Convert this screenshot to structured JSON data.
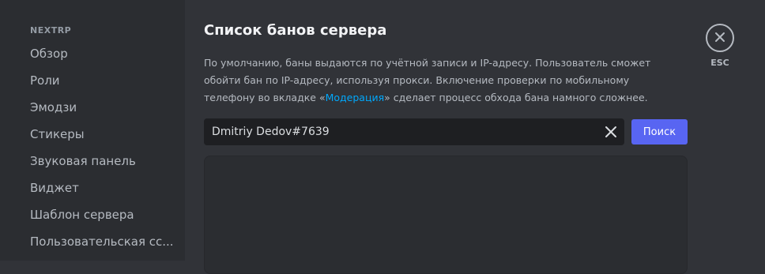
{
  "sidebar": {
    "header": "NEXTRP",
    "items": [
      {
        "label": "Обзор"
      },
      {
        "label": "Роли"
      },
      {
        "label": "Эмодзи"
      },
      {
        "label": "Стикеры"
      },
      {
        "label": "Звуковая панель"
      },
      {
        "label": "Виджет"
      },
      {
        "label": "Шаблон сервера"
      },
      {
        "label": "Пользовательская сс..."
      }
    ]
  },
  "main": {
    "title": "Список банов сервера",
    "description": {
      "text_before": "По умолчанию, баны выдаются по учётной записи и IP-адресу. Пользователь сможет обойти бан по IP-адресу, используя прокси. Включение проверки по мобильному телефону во вкладке «",
      "link": "Модерация",
      "text_after": "» сделает процесс обхода бана намного сложнее."
    },
    "search": {
      "value": "Dmitriy Dedov#7639",
      "button_label": "Поиск"
    }
  },
  "close": {
    "esc_label": "ESC"
  },
  "icons": {
    "clear": "close-icon",
    "close": "close-circle-icon"
  },
  "colors": {
    "accent": "#5865f2",
    "link": "#00a8fc",
    "background": "#313338",
    "sidebar": "#2b2d31"
  }
}
